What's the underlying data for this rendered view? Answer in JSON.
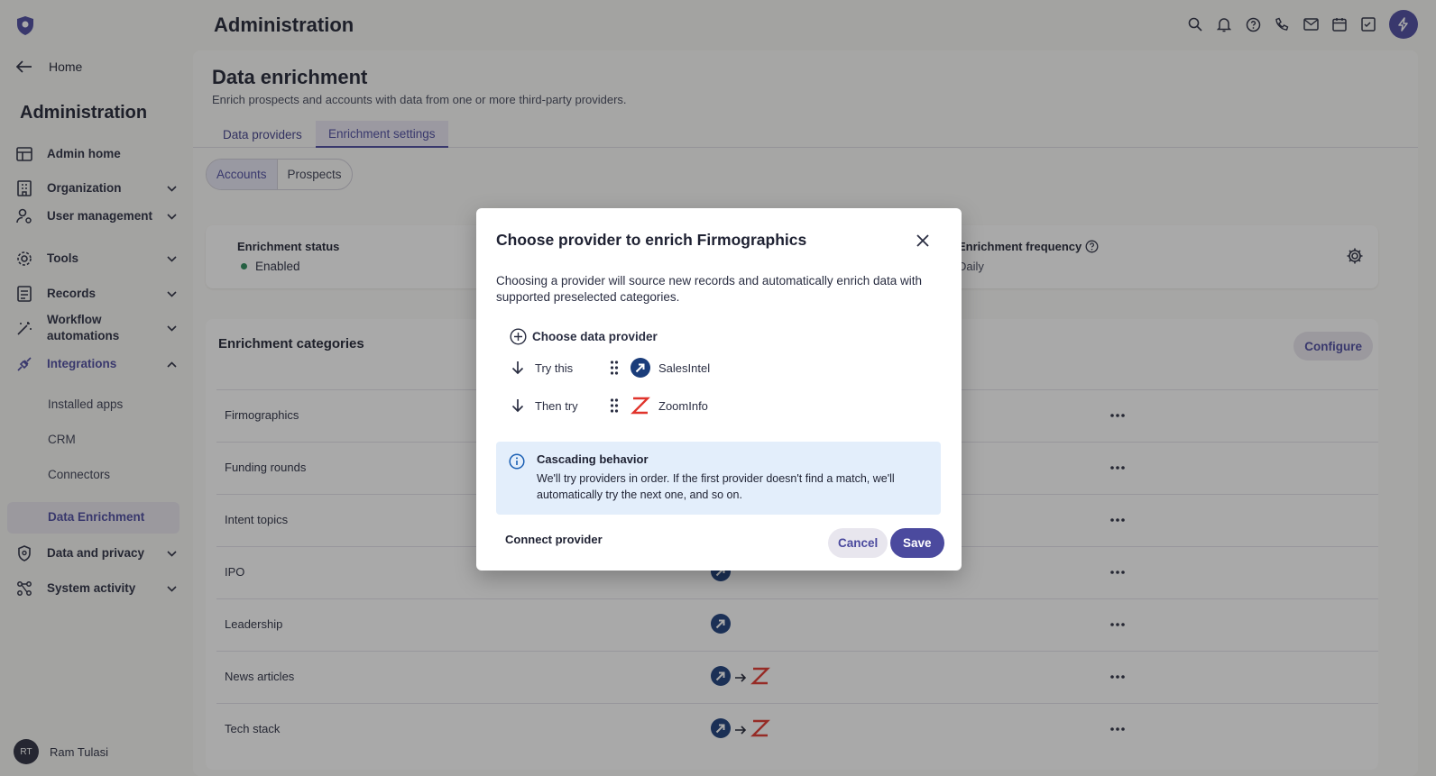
{
  "sidebar": {
    "home": "Home",
    "title": "Administration",
    "items": [
      {
        "label": "Admin home"
      },
      {
        "label": "Organization"
      },
      {
        "label": "User management"
      },
      {
        "label": "Tools"
      },
      {
        "label": "Records"
      },
      {
        "label": "Workflow automations"
      },
      {
        "label": "Integrations"
      },
      {
        "label": "Data and privacy"
      },
      {
        "label": "System activity"
      }
    ],
    "sub_items": [
      {
        "label": "Installed apps"
      },
      {
        "label": "CRM"
      },
      {
        "label": "Connectors"
      },
      {
        "label": "Data Enrichment"
      }
    ],
    "user": {
      "initials": "RT",
      "name": "Ram Tulasi"
    }
  },
  "header": {
    "title": "Administration"
  },
  "page": {
    "title": "Data enrichment",
    "subtitle": "Enrich prospects and accounts with data from one or more third-party providers.",
    "tabs": [
      {
        "label": "Data providers"
      },
      {
        "label": "Enrichment settings"
      }
    ],
    "segments": [
      {
        "label": "Accounts"
      },
      {
        "label": "Prospects"
      }
    ]
  },
  "status_card": {
    "status_label": "Enrichment status",
    "status_value": "Enabled",
    "frequency_label": "Enrichment frequency",
    "frequency_value": "Daily"
  },
  "categories": {
    "title": "Enrichment categories",
    "configure": "Configure",
    "rows": [
      {
        "name": "Firmographics",
        "providers": []
      },
      {
        "name": "Funding rounds",
        "providers": []
      },
      {
        "name": "Intent topics",
        "providers": []
      },
      {
        "name": "IPO",
        "providers": [
          "salesintel"
        ]
      },
      {
        "name": "Leadership",
        "providers": [
          "salesintel"
        ]
      },
      {
        "name": "News articles",
        "providers": [
          "salesintel",
          "zoominfo"
        ]
      },
      {
        "name": "Tech stack",
        "providers": [
          "salesintel",
          "zoominfo"
        ]
      }
    ]
  },
  "modal": {
    "title": "Choose provider to enrich Firmographics",
    "description": "Choosing a provider will source new records and automatically enrich data with supported preselected categories.",
    "choose_label": "Choose data provider",
    "providers": [
      {
        "order_label": "Try this",
        "name": "SalesIntel"
      },
      {
        "order_label": "Then try",
        "name": "ZoomInfo"
      }
    ],
    "info_title": "Cascading behavior",
    "info_body": "We'll try providers in order. If the first provider doesn't find a match, we'll automatically try the next one, and so on.",
    "connect": "Connect provider",
    "cancel": "Cancel",
    "save": "Save"
  },
  "colors": {
    "accent": "#4b4a9e",
    "info_bg": "#e3eefb",
    "salesintel": "#1a3c7a",
    "zoominfo": "#e0342c",
    "enabled": "#2a8a5a"
  }
}
